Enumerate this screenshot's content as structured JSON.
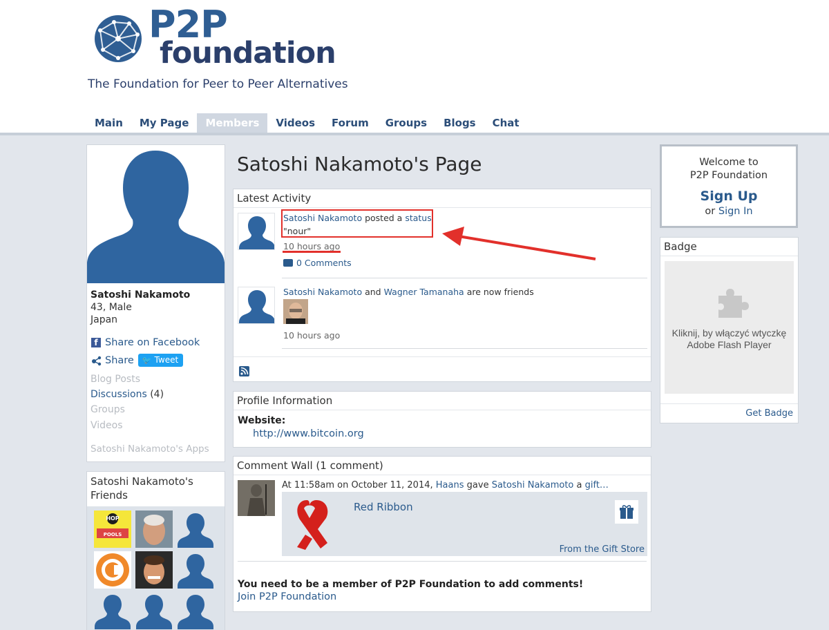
{
  "header": {
    "logo_p2p": "P2P",
    "logo_foundation": "foundation",
    "tagline": "The Foundation for Peer to Peer Alternatives"
  },
  "nav": {
    "tabs": [
      {
        "label": "Main",
        "active": false
      },
      {
        "label": "My Page",
        "active": false
      },
      {
        "label": "Members",
        "active": true
      },
      {
        "label": "Videos",
        "active": false
      },
      {
        "label": "Forum",
        "active": false
      },
      {
        "label": "Groups",
        "active": false
      },
      {
        "label": "Blogs",
        "active": false
      },
      {
        "label": "Chat",
        "active": false
      }
    ]
  },
  "profile": {
    "name": "Satoshi Nakamoto",
    "age_gender": "43, Male",
    "location": "Japan",
    "share_facebook": "Share on Facebook",
    "share": "Share",
    "tweet": "Tweet",
    "links": {
      "blog_posts": "Blog Posts",
      "discussions": "Discussions",
      "discussions_count": "(4)",
      "groups": "Groups",
      "videos": "Videos",
      "apps": "Satoshi Nakamoto's Apps"
    },
    "friends_title": "Satoshi Nakamoto's Friends"
  },
  "main": {
    "page_title": "Satoshi Nakamoto's Page",
    "latest_activity": {
      "heading": "Latest Activity",
      "item1": {
        "actor": "Satoshi Nakamoto",
        "verb": "posted a",
        "object": "status",
        "status_text": "\"nour\"",
        "time": "10 hours ago",
        "comments": "0 Comments"
      },
      "item2": {
        "actor": "Satoshi Nakamoto",
        "and": "and",
        "friend": "Wagner Tamanaha",
        "suffix": "are now friends",
        "time": "10 hours ago"
      }
    },
    "profile_info": {
      "heading": "Profile Information",
      "website_label": "Website:",
      "website_url": "http://www.bitcoin.org"
    },
    "comment_wall": {
      "heading": "Comment Wall (1 comment)",
      "prefix": "At 11:58am on October 11, 2014,",
      "sender": "Haans",
      "gave": "gave",
      "recipient": "Satoshi Nakamoto",
      "a": "a",
      "gift_link": "gift…",
      "gift_name": "Red Ribbon",
      "gift_store": "From the Gift Store",
      "member_msg": "You need to be a member of P2P Foundation to add comments!",
      "join": "Join P2P Foundation"
    }
  },
  "sidebar_right": {
    "welcome_line1": "Welcome to",
    "welcome_line2": "P2P Foundation",
    "sign_up": "Sign Up",
    "or": "or",
    "sign_in": "Sign In",
    "badge_heading": "Badge",
    "flash_text": "Kliknij, by włączyć wtyczkę Adobe Flash Player",
    "get_badge": "Get Badge"
  },
  "colors": {
    "link": "#2a5a8c",
    "annotation_red": "#e2302b",
    "nav_active_bg": "#d0d7e1",
    "page_bg": "#e2e6ec",
    "silhouette": "#2f65a0"
  }
}
